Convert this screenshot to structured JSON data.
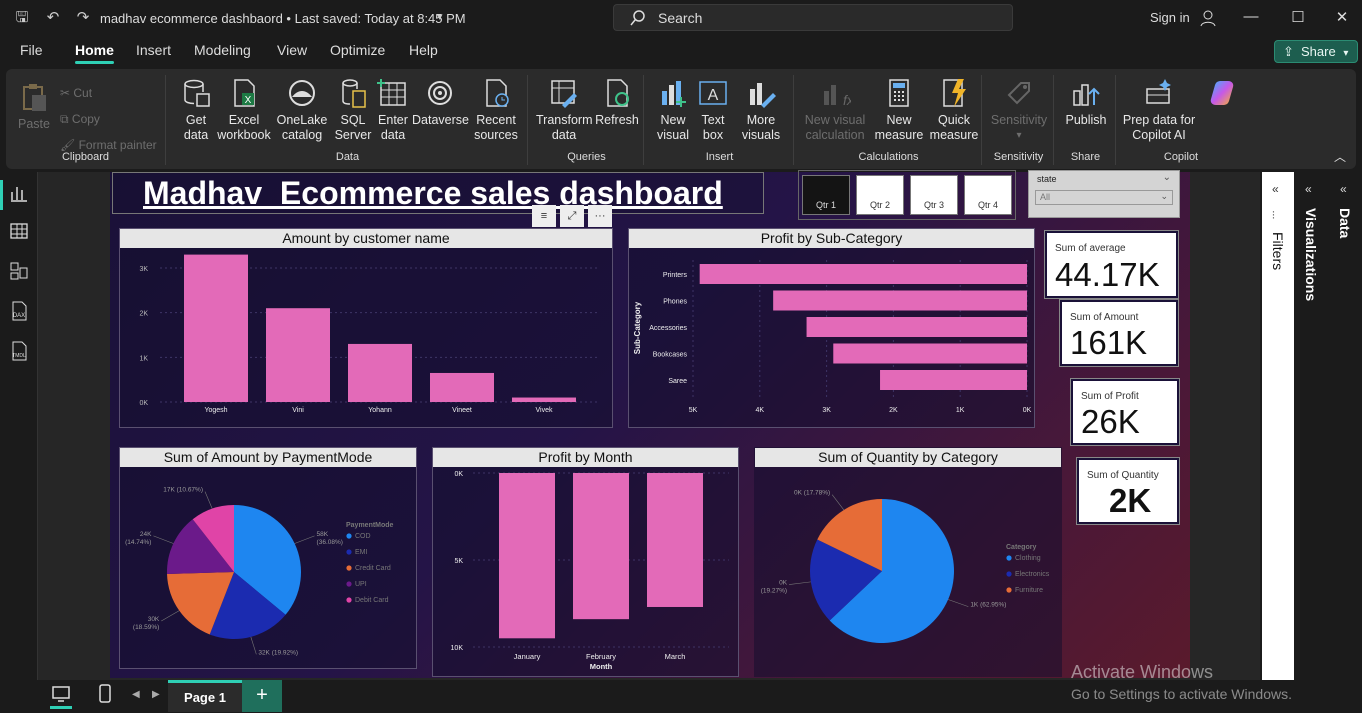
{
  "titlebar": {
    "doc_title": "madhav ecommerce dashbaord • Last saved: Today at 8:45 PM",
    "search_placeholder": "Search",
    "signin": "Sign in"
  },
  "menu": [
    "File",
    "Home",
    "Insert",
    "Modeling",
    "View",
    "Optimize",
    "Help"
  ],
  "share_label": "Share",
  "ribbon": {
    "clipboard": {
      "paste": "Paste",
      "cut": "Cut",
      "copy": "Copy",
      "format_painter": "Format painter",
      "label": "Clipboard"
    },
    "data": {
      "get_data": "Get data",
      "excel": "Excel workbook",
      "onelake": "OneLake catalog",
      "sql": "SQL Server",
      "enter": "Enter data",
      "dataverse": "Dataverse",
      "recent": "Recent sources",
      "label": "Data"
    },
    "queries": {
      "transform": "Transform data",
      "refresh": "Refresh",
      "label": "Queries"
    },
    "insert": {
      "new_visual": "New visual",
      "text_box": "Text box",
      "more_visuals": "More visuals",
      "label": "Insert"
    },
    "calculations": {
      "new_visual_calc": "New visual calculation",
      "new_measure": "New measure",
      "quick_measure": "Quick measure",
      "label": "Calculations"
    },
    "sensitivity": {
      "btn": "Sensitivity",
      "label": "Sensitivity"
    },
    "share": {
      "publish": "Publish",
      "label": "Share"
    },
    "copilot": {
      "prep": "Prep data for Copilot AI",
      "label": "Copilot"
    }
  },
  "report": {
    "title": "Madhav  Ecommerce sales dashboard",
    "quarters": [
      "Qtr 1",
      "Qtr 2",
      "Qtr 3",
      "Qtr 4"
    ],
    "slicer": {
      "label": "state",
      "value": "All"
    },
    "kpis": [
      {
        "label": "Sum of average",
        "value": "44.17K"
      },
      {
        "label": "Sum of Amount",
        "value": "161K"
      },
      {
        "label": "Sum of Profit",
        "value": "26K"
      },
      {
        "label": "Sum of Quantity",
        "value": "2K"
      }
    ]
  },
  "chart_data": [
    {
      "type": "bar",
      "title": "Amount by customer name",
      "categories": [
        "Yogesh",
        "Vini",
        "Yohann",
        "Vineet",
        "Vivek"
      ],
      "values": [
        3300,
        2100,
        1300,
        650,
        100
      ],
      "ylim": [
        0,
        3000
      ],
      "yticks": [
        "0K",
        "1K",
        "2K",
        "3K"
      ],
      "color": "#e36ab8"
    },
    {
      "type": "bar",
      "orientation": "horizontal",
      "title": "Profit by Sub-Category",
      "categories": [
        "Printers",
        "Phones",
        "Accessories",
        "Bookcases",
        "Saree"
      ],
      "values": [
        4900,
        3800,
        3300,
        2900,
        2200
      ],
      "ylabel": "Sub-Category",
      "xticks": [
        "5K",
        "4K",
        "3K",
        "2K",
        "1K",
        "0K"
      ],
      "color": "#e36ab8"
    },
    {
      "type": "pie",
      "title": "Sum of Amount by PaymentMode",
      "legend_title": "PaymentMode",
      "series": [
        {
          "name": "COD",
          "value": 58000,
          "label": "58K",
          "pct": "(36.08%)",
          "color": "#1e86f0"
        },
        {
          "name": "EMI",
          "value": 32000,
          "label": "32K (19.92%)",
          "pct": "",
          "color": "#1b2bb0"
        },
        {
          "name": "Credit Card",
          "value": 30000,
          "label": "30K",
          "pct": "(18.59%)",
          "color": "#e66c37"
        },
        {
          "name": "UPI",
          "value": 24000,
          "label": "24K",
          "pct": "(14.74%)",
          "color": "#6b1a8a"
        },
        {
          "name": "Debit Card",
          "value": 17000,
          "label": "17K (10.67%)",
          "pct": "",
          "color": "#e044a7"
        }
      ]
    },
    {
      "type": "bar",
      "title": "Profit by Month",
      "categories": [
        "January",
        "February",
        "March"
      ],
      "values": [
        -9500,
        -8400,
        -7700
      ],
      "xlabel": "Month",
      "yticks": [
        "0K",
        "5K",
        "10K"
      ],
      "color": "#e36ab8"
    },
    {
      "type": "pie",
      "title": "Sum of Quantity by Category",
      "legend_title": "Category",
      "series": [
        {
          "name": "Clothing",
          "value": 62.95,
          "label": "1K (62.95%)",
          "pct": "",
          "color": "#1e86f0"
        },
        {
          "name": "Electronics",
          "value": 19.27,
          "label": "0K",
          "pct": "(19.27%)",
          "color": "#1b2bb0"
        },
        {
          "name": "Furniture",
          "value": 17.78,
          "label": "0K (17.78%)",
          "pct": "",
          "color": "#e66c37"
        }
      ]
    }
  ],
  "panes": {
    "filters": "Filters",
    "visualizations": "Visualizations",
    "data": "Data"
  },
  "status": {
    "page": "Page 1",
    "add": "+"
  },
  "watermark": {
    "line1": "Activate Windows",
    "line2": "Go to Settings to activate Windows."
  }
}
